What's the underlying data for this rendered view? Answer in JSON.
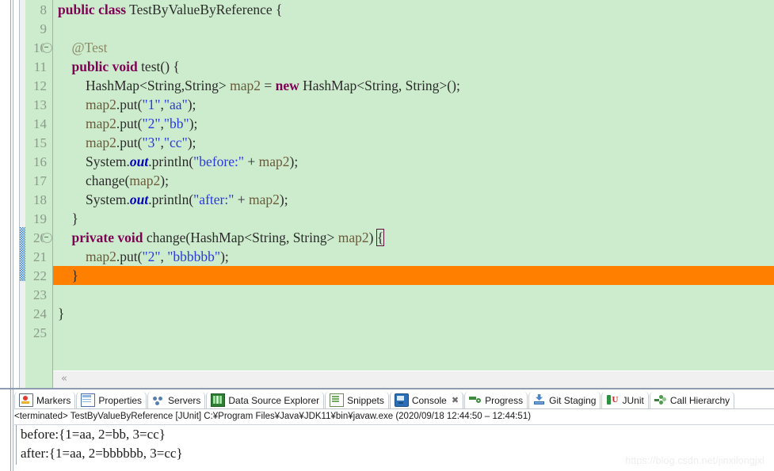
{
  "editor": {
    "first_visible_line": 8,
    "highlighted_line": 22,
    "lines": [
      {
        "num": "8",
        "fold": false,
        "text": "public class TestByValueByReference {"
      },
      {
        "num": "9",
        "fold": false,
        "text": ""
      },
      {
        "num": "10",
        "fold": true,
        "text": "    @Test"
      },
      {
        "num": "11",
        "fold": false,
        "text": "    public void test() {"
      },
      {
        "num": "12",
        "fold": false,
        "text": "        HashMap<String,String> map2 = new HashMap<String, String>();"
      },
      {
        "num": "13",
        "fold": false,
        "text": "        map2.put(\"1\",\"aa\");"
      },
      {
        "num": "14",
        "fold": false,
        "text": "        map2.put(\"2\",\"bb\");"
      },
      {
        "num": "15",
        "fold": false,
        "text": "        map2.put(\"3\",\"cc\");"
      },
      {
        "num": "16",
        "fold": false,
        "text": "        System.out.println(\"before:\" + map2);"
      },
      {
        "num": "17",
        "fold": false,
        "text": "        change(map2);"
      },
      {
        "num": "18",
        "fold": false,
        "text": "        System.out.println(\"after:\" + map2);"
      },
      {
        "num": "19",
        "fold": false,
        "text": "    }"
      },
      {
        "num": "20",
        "fold": true,
        "text": "    private void change(HashMap<String, String> map2) {"
      },
      {
        "num": "21",
        "fold": false,
        "text": "        map2.put(\"2\", \"bbbbbb\");"
      },
      {
        "num": "22",
        "fold": false,
        "text": "    }"
      },
      {
        "num": "23",
        "fold": false,
        "text": ""
      },
      {
        "num": "24",
        "fold": false,
        "text": "}"
      },
      {
        "num": "25",
        "fold": false,
        "text": ""
      }
    ],
    "scroll_chevron": "«",
    "colors": {
      "background": "#cdeccd",
      "highlight": "#ff8000",
      "keyword": "#7f0055",
      "string": "#2a38e0",
      "annotation": "#8a8a66",
      "static_field": "#0000c0",
      "line_number": "#8a9a8a",
      "range_marker": "#1e7ad2"
    }
  },
  "bottom_panel": {
    "tabs": [
      {
        "label": "Markers",
        "icon": "markers-icon",
        "selected": false,
        "closeable": false
      },
      {
        "label": "Properties",
        "icon": "properties-icon",
        "selected": false,
        "closeable": false
      },
      {
        "label": "Servers",
        "icon": "servers-icon",
        "selected": false,
        "closeable": false
      },
      {
        "label": "Data Source Explorer",
        "icon": "database-icon",
        "selected": false,
        "closeable": false
      },
      {
        "label": "Snippets",
        "icon": "snippets-icon",
        "selected": false,
        "closeable": false
      },
      {
        "label": "Console",
        "icon": "console-icon",
        "selected": true,
        "closeable": true
      },
      {
        "label": "Progress",
        "icon": "progress-icon",
        "selected": false,
        "closeable": false
      },
      {
        "label": "Git Staging",
        "icon": "git-icon",
        "selected": false,
        "closeable": false
      },
      {
        "label": "JUnit",
        "icon": "junit-icon",
        "selected": false,
        "closeable": false
      },
      {
        "label": "Call Hierarchy",
        "icon": "call-hierarchy-icon",
        "selected": false,
        "closeable": false
      }
    ],
    "close_glyph": "✖",
    "status_line": "<terminated> TestByValueByReference [JUnit] C:¥Program Files¥Java¥JDK11¥bin¥javaw.exe  (2020/09/18 12:44:50 – 12:44:51)",
    "console_output": "before:{1=aa, 2=bb, 3=cc}\nafter:{1=aa, 2=bbbbbb, 3=cc}"
  },
  "watermark": "https://blog.csdn.net/jinxilongjxl"
}
